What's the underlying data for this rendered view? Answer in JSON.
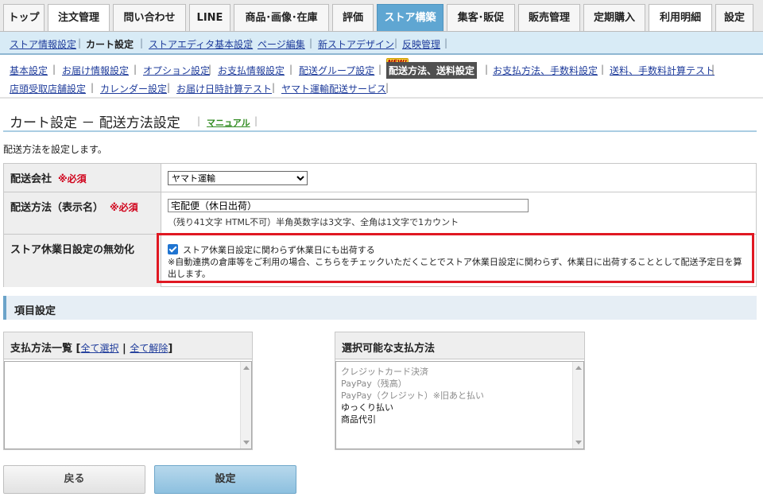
{
  "main_tabs": [
    {
      "label": "トップ"
    },
    {
      "label": "注文管理"
    },
    {
      "label": "問い合わせ"
    },
    {
      "label": "LINE"
    },
    {
      "label": "商品･画像･在庫"
    },
    {
      "label": "評価"
    },
    {
      "label": "ストア構築"
    },
    {
      "label": "集客･販促"
    },
    {
      "label": "販売管理"
    },
    {
      "label": "定期購入"
    },
    {
      "label": "利用明細"
    },
    {
      "label": "設定"
    }
  ],
  "sub_nav": [
    {
      "label": "ストア情報設定"
    },
    {
      "label": "カート設定"
    },
    {
      "label": "ストアエディタ基本設定"
    },
    {
      "label": "ページ編集"
    },
    {
      "label": "新ストアデザイン"
    },
    {
      "label": "反映管理"
    }
  ],
  "third_nav": [
    {
      "label": "基本設定"
    },
    {
      "label": "お届け情報設定"
    },
    {
      "label": "オプション設定"
    },
    {
      "label": "お支払情報設定"
    },
    {
      "label": "配送グループ設定"
    },
    {
      "label": "配送方法、送料設定"
    },
    {
      "label": "お支払方法、手数料設定"
    },
    {
      "label": "送料、手数料計算テスト"
    },
    {
      "label": "店頭受取店舗設定"
    },
    {
      "label": "カレンダー設定"
    },
    {
      "label": "お届け日時計算テスト"
    },
    {
      "label": "ヤマト運輸配送サービス"
    }
  ],
  "new_badge": "NEW!",
  "page": {
    "title": "カート設定 － 配送方法設定",
    "manual": "マニュアル",
    "description": "配送方法を設定します。"
  },
  "form": {
    "company_label": "配送会社",
    "company_value": "ヤマト運輸",
    "required": "※必須",
    "method_label": "配送方法（表示名）",
    "method_value": "宅配便（休日出荷）",
    "method_hint": "（残り41文字  HTML不可）半角英数字は3文字、全角は1文字で1カウント",
    "holiday_label": "ストア休業日設定の無効化",
    "holiday_checkbox_label": "ストア休業日設定に関わらず休業日にも出荷する",
    "holiday_checked": true,
    "holiday_note": "※自動連携の倉庫等をご利用の場合、こちらをチェックいただくことでストア休業日設定に関わらず、休業日に出荷することとして配送予定日を算出します。"
  },
  "section": {
    "title": "項目設定"
  },
  "payment_list": {
    "title": "支払方法一覧",
    "select_all": "全て選択",
    "deselect_all": "全て解除",
    "items": []
  },
  "available_list": {
    "title": "選択可能な支払方法",
    "items": [
      {
        "label": "クレジットカード決済",
        "enabled": false
      },
      {
        "label": "PayPay（残高）",
        "enabled": false
      },
      {
        "label": "PayPay（クレジット）※旧あと払い",
        "enabled": false
      },
      {
        "label": "ゆっくり払い",
        "enabled": true
      },
      {
        "label": "商品代引",
        "enabled": true
      }
    ]
  },
  "buttons": {
    "back": "戻る",
    "submit": "設定"
  }
}
